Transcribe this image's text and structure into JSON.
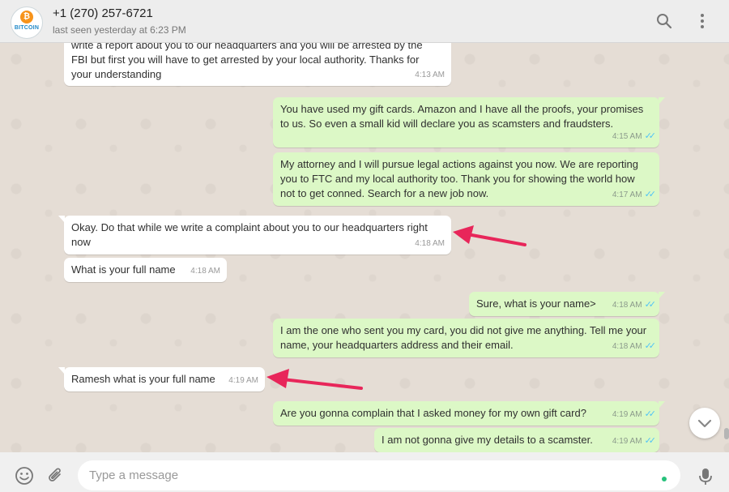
{
  "header": {
    "avatar_brand": "BITCOIN",
    "avatar_symbol": "₿",
    "contact_name": "+1 (270) 257-6721",
    "last_seen": "last seen yesterday at 6:23 PM",
    "icons": [
      "search-icon",
      "menu-icon"
    ]
  },
  "messages": [
    {
      "dir": "in",
      "text": "write a report about you to our headquarters and you will be arrested by the FBI but first you will have to get arrested by your local authority. Thanks for your understanding",
      "time": "4:13 AM"
    },
    {
      "dir": "out",
      "text": "You have used my gift cards. Amazon and I have all the proofs, your promises to us. So even a small kid will declare you as scamsters and fraudsters.",
      "time": "4:15 AM"
    },
    {
      "dir": "out",
      "text": "My attorney and I will pursue legal actions against you now. We are reporting you to FTC and my local authority too. Thank you for showing the world how not to get conned. Search for a new job now.",
      "time": "4:17 AM"
    },
    {
      "dir": "in",
      "text": "Okay. Do that while we write a complaint about you to our headquarters right now",
      "time": "4:18 AM"
    },
    {
      "dir": "in",
      "text": "What is your full name",
      "time": "4:18 AM"
    },
    {
      "dir": "out",
      "text": "Sure, what is your name>",
      "time": "4:18 AM"
    },
    {
      "dir": "out",
      "text": "I am the one who sent you my card, you did not give me anything. Tell me your name, your headquarters address and their email.",
      "time": "4:18 AM"
    },
    {
      "dir": "in",
      "text": "Ramesh what is your full name",
      "time": "4:19 AM"
    },
    {
      "dir": "out",
      "text": "Are you gonna complain that I asked money for my own gift card?",
      "time": "4:19 AM"
    },
    {
      "dir": "out",
      "text": "I am not gonna give my details to a scamster.",
      "time": "4:19 AM"
    }
  ],
  "footer": {
    "placeholder": "Type a message",
    "icons": [
      "emoji-icon",
      "attach-icon",
      "microphone-icon"
    ]
  },
  "colors": {
    "incoming": "#ffffff",
    "outgoing": "#dcf8c6",
    "background": "#e5ddd5",
    "read_ticks": "#4fc3f7",
    "annotation_arrow": "#e8265a"
  }
}
